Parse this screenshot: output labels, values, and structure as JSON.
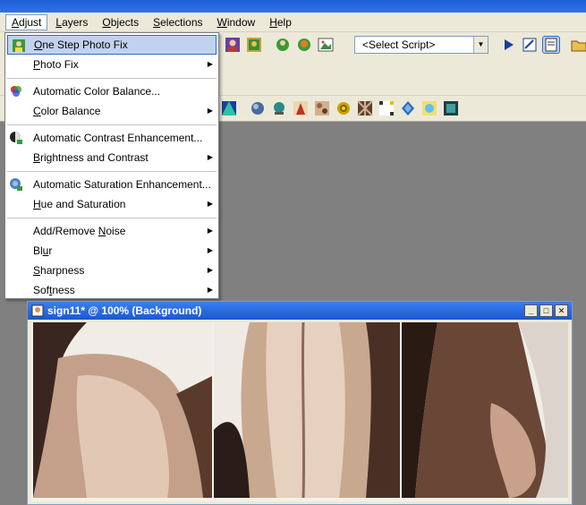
{
  "menubar": {
    "items": [
      {
        "label": "Adjust",
        "key": "A",
        "rest": "djust"
      },
      {
        "label": "Layers",
        "key": "L",
        "rest": "ayers"
      },
      {
        "label": "Objects",
        "key": "O",
        "rest": "bjects"
      },
      {
        "label": "Selections",
        "key": "S",
        "rest": "elections"
      },
      {
        "label": "Window",
        "key": "W",
        "rest": "indow"
      },
      {
        "label": "Help",
        "key": "H",
        "rest": "elp"
      }
    ]
  },
  "toolbar": {
    "script_select": "<Select Script>"
  },
  "adjust_menu": {
    "one_step_photo_fix": {
      "pre": "",
      "key": "O",
      "post": "ne Step Photo Fix"
    },
    "photo_fix": {
      "pre": "",
      "key": "P",
      "post": "hoto Fix"
    },
    "automatic_color_balance": {
      "pre": "Automatic Color Balance...",
      "key": "",
      "post": ""
    },
    "color_balance": {
      "pre": "",
      "key": "C",
      "post": "olor Balance"
    },
    "automatic_contrast": {
      "pre": "Automatic Contrast Enhancement...",
      "key": "",
      "post": ""
    },
    "brightness_contrast": {
      "pre": "",
      "key": "B",
      "post": "rightness and Contrast"
    },
    "automatic_saturation": {
      "pre": "Automatic Saturation Enhancement...",
      "key": "",
      "post": ""
    },
    "hue_saturation": {
      "pre": "",
      "key": "H",
      "post": "ue and Saturation"
    },
    "add_remove_noise": {
      "pre": "Add/Remove ",
      "key": "N",
      "post": "oise"
    },
    "blur": {
      "pre": "Bl",
      "key": "u",
      "post": "r"
    },
    "sharpness": {
      "pre": "",
      "key": "S",
      "post": "harpness"
    },
    "softness": {
      "pre": "Sof",
      "key": "t",
      "post": "ness"
    }
  },
  "image_window": {
    "title": "sign11* @ 100% (Background)"
  },
  "colors": {
    "menu_highlight": "#c1d2ee",
    "window_title": "#1c58d0",
    "workspace": "#808080"
  }
}
